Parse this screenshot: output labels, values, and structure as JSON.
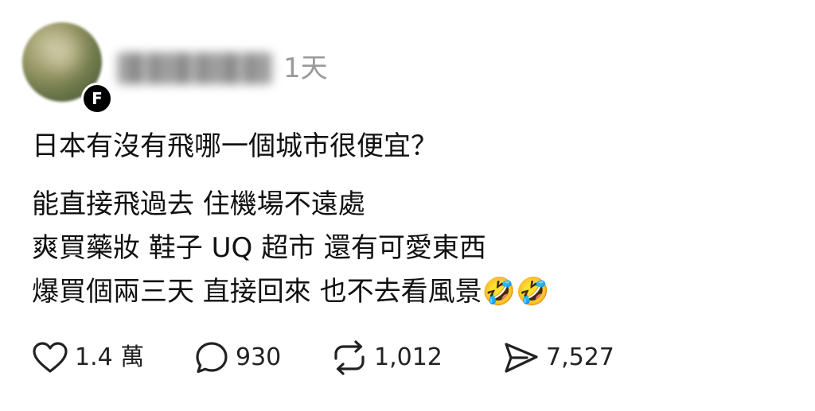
{
  "post": {
    "timestamp": "1天",
    "platform_badge": "F",
    "title": "日本有沒有飛哪一個城市很便宜？",
    "body_lines": [
      "能直接飛過去 住機場不遠處",
      "爽買藥妝 鞋子 UQ 超市 還有可愛東西",
      "爆買個兩三天 直接回來 也不去看風景🤣🤣"
    ]
  },
  "actions": {
    "likes": "1.4 萬",
    "comments": "930",
    "reposts": "1,012",
    "shares": "7,527"
  },
  "icons": {
    "like": "heart-icon",
    "comment": "speech-bubble-icon",
    "repost": "repost-arrows-icon",
    "share": "send-icon"
  }
}
